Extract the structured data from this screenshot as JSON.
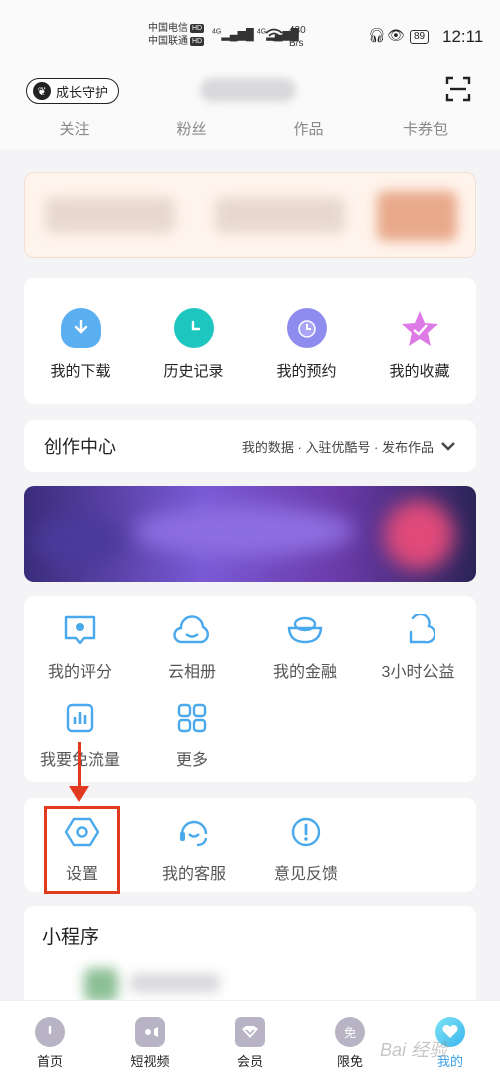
{
  "status_bar": {
    "carrier1": "中国电信",
    "carrier2": "中国联通",
    "hd": "HD",
    "net1": "4G",
    "net2": "4G",
    "speed_value": "430",
    "speed_unit": "B/s",
    "battery": "89",
    "time": "12:11"
  },
  "header": {
    "growth_label": "成长守护",
    "stats": [
      "关注",
      "粉丝",
      "作品",
      "卡券包"
    ]
  },
  "quick_actions": [
    {
      "label": "我的下载",
      "icon": "download-cloud-icon",
      "color": "#5aaff0"
    },
    {
      "label": "历史记录",
      "icon": "clock-icon",
      "color": "#1dc7c0"
    },
    {
      "label": "我的预约",
      "icon": "alarm-clock-icon",
      "color": "#8f8cf0"
    },
    {
      "label": "我的收藏",
      "icon": "star-icon",
      "color": "#d46de0"
    }
  ],
  "creation_center": {
    "title": "创作中心",
    "links": "我的数据 · 入驻优酷号 · 发布作品"
  },
  "services": [
    {
      "label": "我的评分",
      "icon": "rating-icon"
    },
    {
      "label": "云相册",
      "icon": "cloud-album-icon"
    },
    {
      "label": "我的金融",
      "icon": "finance-icon"
    },
    {
      "label": "3小时公益",
      "icon": "charity-icon"
    },
    {
      "label": "我要免流量",
      "icon": "free-data-icon"
    },
    {
      "label": "更多",
      "icon": "more-grid-icon"
    }
  ],
  "settings_row": [
    {
      "label": "设置",
      "icon": "settings-hexagon-icon"
    },
    {
      "label": "我的客服",
      "icon": "customer-service-icon"
    },
    {
      "label": "意见反馈",
      "icon": "feedback-icon"
    }
  ],
  "mini_programs": {
    "title": "小程序"
  },
  "tab_bar": [
    {
      "label": "首页",
      "icon": "home-icon",
      "active": false
    },
    {
      "label": "短视频",
      "icon": "video-icon",
      "active": false
    },
    {
      "label": "会员",
      "icon": "vip-icon",
      "active": false
    },
    {
      "label": "限免",
      "icon": "free-icon",
      "glyph": "免",
      "active": false
    },
    {
      "label": "我的",
      "icon": "profile-icon",
      "active": true
    }
  ],
  "watermark": "Bai 经验",
  "colors": {
    "accent_blue": "#4aa9ec",
    "annotation_red": "#e23a1e",
    "active_tab": "#3aa0e8"
  }
}
